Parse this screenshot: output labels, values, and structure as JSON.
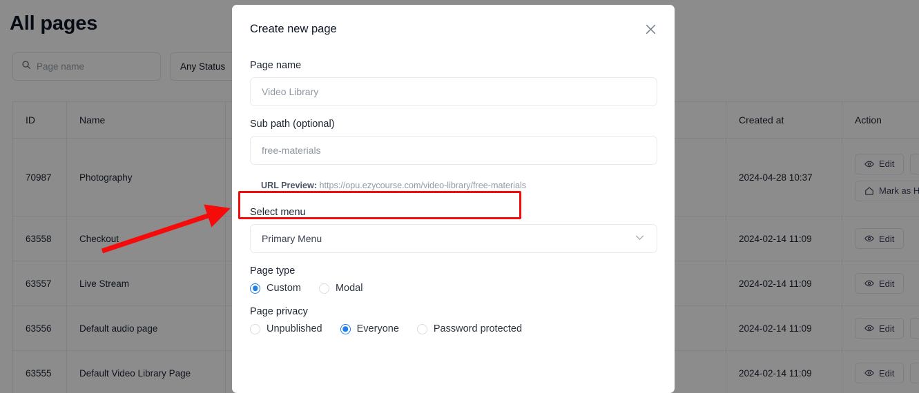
{
  "background": {
    "page_title": "All pages",
    "search": {
      "placeholder": "Page name",
      "icon": "search-icon"
    },
    "status_filter": {
      "label": "Any Status"
    },
    "table": {
      "columns": [
        "ID",
        "Name",
        "",
        "Created at",
        "Action"
      ],
      "rows": [
        {
          "id": "70987",
          "name": "Photography",
          "created_at": "2024-04-28 10:37",
          "actions": [
            "Edit",
            "Mark as Home"
          ]
        },
        {
          "id": "63558",
          "name": "Checkout",
          "created_at": "2024-02-14 11:09",
          "actions": [
            "Edit"
          ]
        },
        {
          "id": "63557",
          "name": "Live Stream",
          "created_at": "2024-02-14 11:09",
          "actions": [
            "Edit"
          ]
        },
        {
          "id": "63556",
          "name": "Default audio page",
          "created_at": "2024-02-14 11:09",
          "actions": [
            "Edit"
          ]
        },
        {
          "id": "63555",
          "name": "Default Video Library Page",
          "created_at": "2024-02-14 11:09",
          "actions": [
            "Edit"
          ]
        }
      ]
    }
  },
  "modal": {
    "title": "Create new page",
    "close_icon": "close-icon",
    "page_name": {
      "label": "Page name",
      "value": "",
      "placeholder": "Video Library"
    },
    "sub_path": {
      "label": "Sub path (optional)",
      "value": "",
      "placeholder": "free-materials"
    },
    "url_preview": {
      "label": "URL Preview:",
      "url": "https://opu.ezycourse.com/video-library/free-materials"
    },
    "select_menu": {
      "label": "Select menu",
      "value": "Primary Menu",
      "chevron_icon": "chevron-down-icon"
    },
    "page_type": {
      "label": "Page type",
      "options": [
        {
          "label": "Custom",
          "selected": true
        },
        {
          "label": "Modal",
          "selected": false
        }
      ]
    },
    "page_privacy": {
      "label": "Page privacy",
      "options": [
        {
          "label": "Unpublished",
          "selected": false
        },
        {
          "label": "Everyone",
          "selected": true
        },
        {
          "label": "Password protected",
          "selected": false
        }
      ]
    }
  },
  "annotations": {
    "highlight_color": "#f60b0b",
    "arrow_color": "#f60b0b",
    "highlight_target": "url-preview"
  },
  "colors": {
    "accent": "#1e7fe8",
    "annotation": "#f60b0b",
    "text": "#0e1726",
    "muted": "#9199a5",
    "border": "#e0e6ed"
  }
}
